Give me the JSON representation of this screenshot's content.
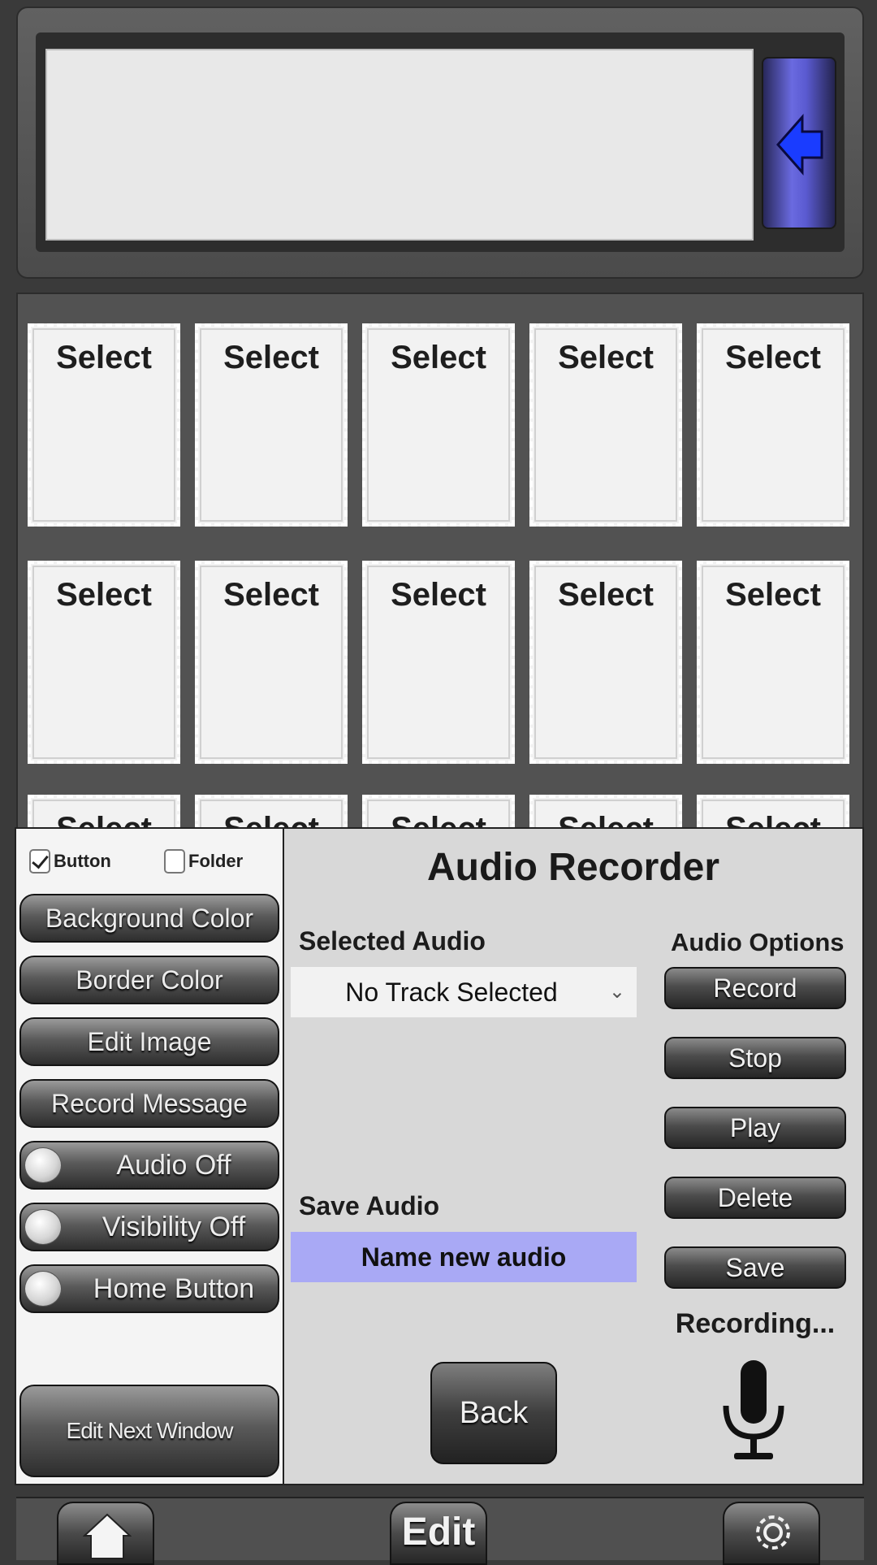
{
  "message_bar": {
    "text": ""
  },
  "grid": {
    "tile_label": "Select",
    "rows": [
      [
        "Select",
        "Select",
        "Select",
        "Select",
        "Select"
      ],
      [
        "Select",
        "Select",
        "Select",
        "Select",
        "Select"
      ],
      [
        "Select",
        "Select",
        "Select",
        "Select",
        "Select"
      ]
    ]
  },
  "sidebar": {
    "button_checkbox": {
      "label": "Button",
      "checked": true
    },
    "folder_checkbox": {
      "label": "Folder",
      "checked": false
    },
    "background_color": "Background Color",
    "border_color": "Border Color",
    "edit_image": "Edit Image",
    "record_message": "Record Message",
    "audio_toggle": "Audio Off",
    "visibility_toggle": "Visibility Off",
    "home_button_toggle": "Home Button",
    "edit_next_window": "Edit Next Window"
  },
  "audio_recorder": {
    "title": "Audio Recorder",
    "selected_audio_label": "Selected Audio",
    "selected_track": "No Track Selected",
    "save_audio_label": "Save Audio",
    "name_placeholder": "Name new audio",
    "options_label": "Audio Options",
    "record": "Record",
    "stop": "Stop",
    "play": "Play",
    "delete": "Delete",
    "save": "Save",
    "status": "Recording...",
    "back": "Back"
  },
  "toolbar": {
    "home_icon": "home-icon",
    "edit": "Edit",
    "settings_icon": "gear-icon"
  },
  "colors": {
    "background": "#3a3a3a",
    "input_highlight": "#a9a9f5",
    "arrow_blue": "#1a1aff"
  }
}
